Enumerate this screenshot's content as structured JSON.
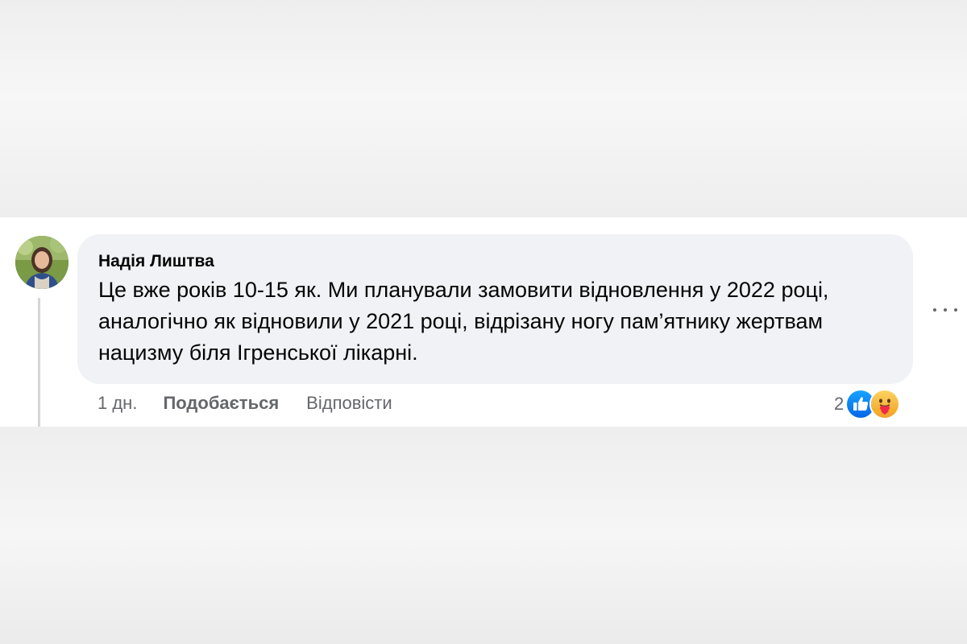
{
  "comment": {
    "author": "Надія Лиштва",
    "text": "Це вже років 10-15 як. Ми планували замовити відновлення у 2022 році, аналогічно як відновили у 2021 році, відрізану ногу пам’ятнику жертвам нацизму біля Ігренської лікарні.",
    "time": "1 дн.",
    "like_label": "Подобається",
    "reply_label": "Відповісти",
    "reaction_count": "2",
    "reactions": [
      "like-icon",
      "care-icon"
    ],
    "more_icon": "more-options-icon"
  },
  "colors": {
    "bubble": "#f0f2f5",
    "text": "#050505",
    "secondary_text": "#65676b",
    "like_blue": "#1877f2",
    "care_yellow": "#f7b125"
  }
}
